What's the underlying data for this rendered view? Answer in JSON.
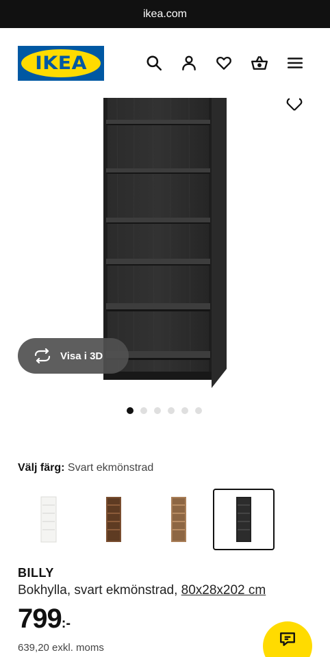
{
  "browser": {
    "url": "ikea.com"
  },
  "header": {
    "logo_text": "IKEA",
    "icons": [
      "search-icon",
      "profile-icon",
      "heart-icon",
      "basket-icon",
      "menu-icon"
    ]
  },
  "gallery": {
    "view_3d_label": "Visa i 3D",
    "image_count": 6,
    "active_index": 0
  },
  "color_selector": {
    "label": "Välj färg:",
    "value": "Svart ekmönstrad",
    "options": [
      {
        "name": "white",
        "color": "#f2f2f0",
        "selected": false
      },
      {
        "name": "brown-walnut",
        "color": "#7a4e30",
        "selected": false
      },
      {
        "name": "oak-veneer",
        "color": "#a97e57",
        "selected": false
      },
      {
        "name": "black-brown",
        "color": "#2a2a2a",
        "selected": true
      }
    ]
  },
  "product": {
    "name": "BILLY",
    "description": "Bokhylla, svart ekmönstrad,",
    "dimensions": "80x28x202 cm",
    "price": "799",
    "price_suffix": ":-",
    "price_excl": "639,20 exkl. moms"
  },
  "colors": {
    "ikea_blue": "#0058a3",
    "ikea_yellow": "#ffdb00"
  }
}
